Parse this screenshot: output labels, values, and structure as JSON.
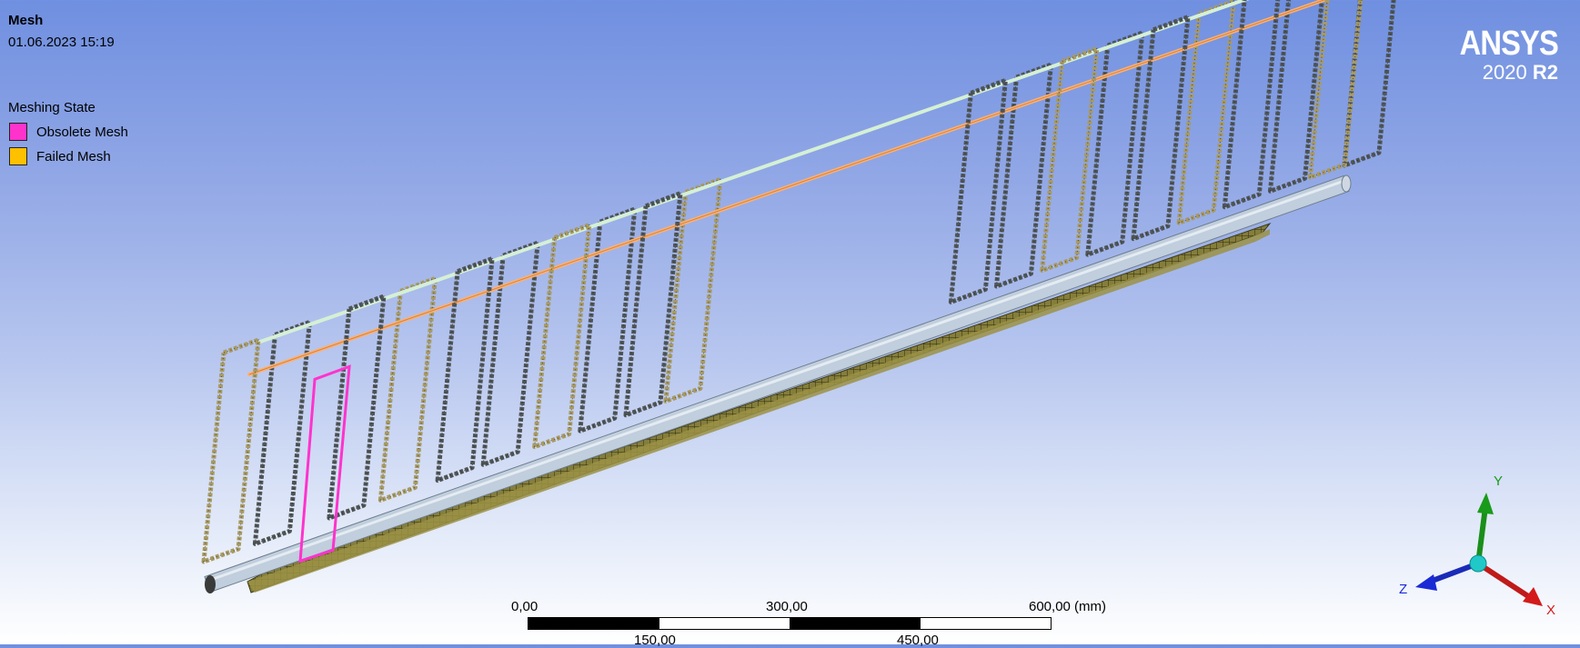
{
  "viewport": {
    "title": "Mesh",
    "timestamp": "01.06.2023 15:19"
  },
  "legend": {
    "heading": "Meshing State",
    "items": [
      {
        "label": "Obsolete Mesh",
        "color": "#ff33cc"
      },
      {
        "label": "Failed Mesh",
        "color": "#ffc000"
      }
    ]
  },
  "logo": {
    "brand": "ANSYS",
    "version": "2020",
    "release": "R2"
  },
  "scale": {
    "top_labels": [
      "0,00",
      "300,00",
      "600,00 (mm)"
    ],
    "bottom_labels": [
      "150,00",
      "450,00"
    ]
  },
  "triad": {
    "axes": [
      {
        "label": "Y",
        "color": "#1a9a1a"
      },
      {
        "label": "Z",
        "color": "#1a2bd6"
      },
      {
        "label": "X",
        "color": "#d41a1a"
      }
    ]
  },
  "colors": {
    "rebar_bright": "#ffb070",
    "top_bar": "#d5f0d5",
    "pipe": "#c0cedd",
    "mesh_plate": "#857e3a",
    "obsolete_highlight": "#ff33cc"
  }
}
